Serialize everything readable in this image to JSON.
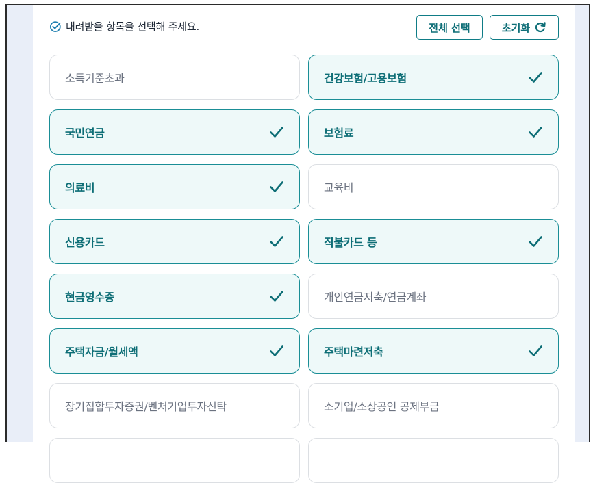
{
  "header": {
    "instruction": "내려받을 항목을 선택해 주세요.",
    "select_all_label": "전체 선택",
    "reset_label": "초기화"
  },
  "colors": {
    "accent": "#0f7c86",
    "selected_bg": "#eef9f9",
    "unselected_border": "#dcdfe3",
    "outer_bg": "#e9eef8"
  },
  "icons": {
    "instruction": "check-circle-icon",
    "reset": "refresh-icon",
    "item_selected": "checkmark-icon"
  },
  "items": [
    {
      "label": "소득기준초과",
      "selected": false
    },
    {
      "label": "건강보험/고용보험",
      "selected": true
    },
    {
      "label": "국민연금",
      "selected": true
    },
    {
      "label": "보험료",
      "selected": true
    },
    {
      "label": "의료비",
      "selected": true
    },
    {
      "label": "교육비",
      "selected": false
    },
    {
      "label": "신용카드",
      "selected": true
    },
    {
      "label": "직불카드 등",
      "selected": true
    },
    {
      "label": "현금영수증",
      "selected": true
    },
    {
      "label": "개인연금저축/연금계좌",
      "selected": false
    },
    {
      "label": "주택자금/월세액",
      "selected": true
    },
    {
      "label": "주택마련저축",
      "selected": true
    },
    {
      "label": "장기집합투자증권/벤처기업투자신탁",
      "selected": false
    },
    {
      "label": "소기업/소상공인 공제부금",
      "selected": false
    },
    {
      "label": "",
      "selected": false
    },
    {
      "label": "",
      "selected": false
    }
  ]
}
